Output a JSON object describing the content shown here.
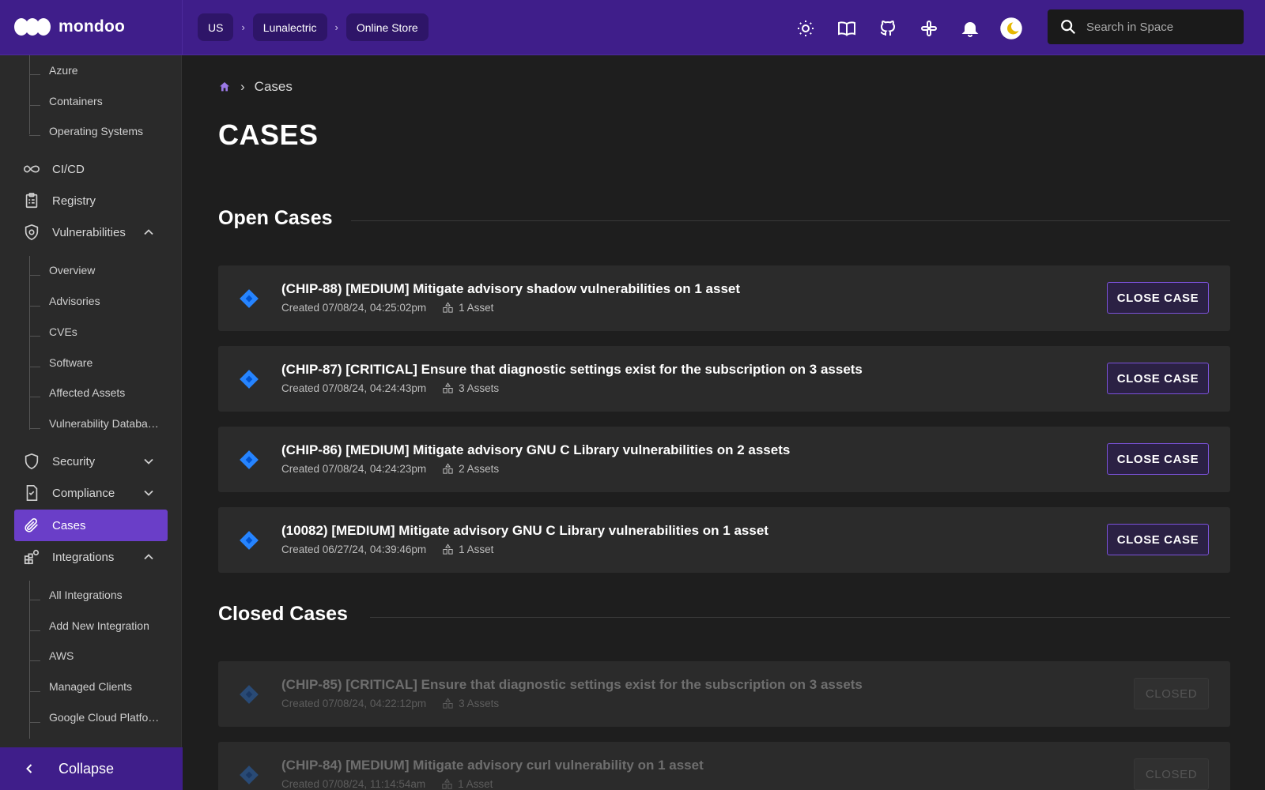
{
  "app": {
    "logo_text": "mondoo"
  },
  "topbar": {
    "breadcrumbs": [
      {
        "label": "US"
      },
      {
        "label": "Lunalectric"
      },
      {
        "label": "Online Store"
      }
    ],
    "separator": "›",
    "icons": [
      "sun-icon",
      "book-icon",
      "github-icon",
      "slack-icon",
      "bell-icon",
      "theme-toggle-icon"
    ],
    "search_placeholder": "Search in Space"
  },
  "sidebar": {
    "top_subitems": [
      "Azure",
      "Containers",
      "Operating Systems"
    ],
    "nav": {
      "cicd": "CI/CD",
      "registry": "Registry",
      "vulnerabilities": "Vulnerabilities",
      "security": "Security",
      "compliance": "Compliance",
      "cases": "Cases",
      "integrations": "Integrations"
    },
    "vuln_subitems": [
      "Overview",
      "Advisories",
      "CVEs",
      "Software",
      "Affected Assets",
      "Vulnerability Databa…"
    ],
    "integration_subitems": [
      "All Integrations",
      "Add New Integration",
      "AWS",
      "Managed Clients",
      "Google Cloud Platfo…"
    ],
    "collapse_label": "Collapse"
  },
  "main": {
    "breadcrumb_current": "Cases",
    "breadcrumb_sep": "›",
    "page_title": "CASES",
    "open_section": "Open Cases",
    "closed_section": "Closed Cases",
    "open_cases": [
      {
        "title": "(CHIP-88) [MEDIUM] Mitigate advisory shadow vulnerabilities on 1 asset",
        "created": "Created 07/08/24, 04:25:02pm",
        "assets": "1 Asset",
        "button": "CLOSE CASE"
      },
      {
        "title": "(CHIP-87) [CRITICAL] Ensure that diagnostic settings exist for the subscription on 3 assets",
        "created": "Created 07/08/24, 04:24:43pm",
        "assets": "3 Assets",
        "button": "CLOSE CASE"
      },
      {
        "title": "(CHIP-86) [MEDIUM] Mitigate advisory GNU C Library vulnerabilities on 2 assets",
        "created": "Created 07/08/24, 04:24:23pm",
        "assets": "2 Assets",
        "button": "CLOSE CASE"
      },
      {
        "title": "(10082) [MEDIUM] Mitigate advisory GNU C Library vulnerabilities on 1 asset",
        "created": "Created 06/27/24, 04:39:46pm",
        "assets": "1 Asset",
        "button": "CLOSE CASE"
      }
    ],
    "closed_cases": [
      {
        "title": "(CHIP-85) [CRITICAL] Ensure that diagnostic settings exist for the subscription on 3 assets",
        "created": "Created 07/08/24, 04:22:12pm",
        "assets": "3 Assets",
        "button": "CLOSED"
      },
      {
        "title": "(CHIP-84) [MEDIUM] Mitigate advisory curl vulnerability on 1 asset",
        "created": "Created 07/08/24, 11:14:54am",
        "assets": "1 Asset",
        "button": "CLOSED"
      }
    ]
  },
  "colors": {
    "brand": "#3f1e8a",
    "accent": "#6a3ec8",
    "jira_blue": "#2684ff"
  }
}
